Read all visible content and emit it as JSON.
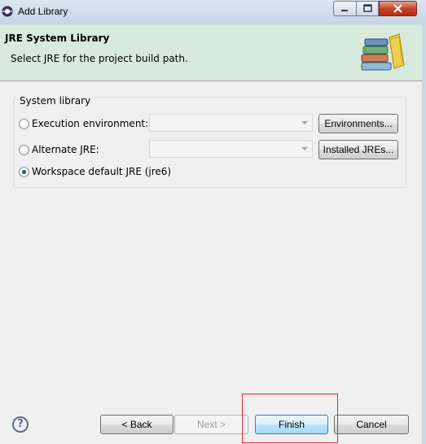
{
  "window": {
    "title": "Add Library",
    "controls": {
      "minimize": "minimize",
      "maximize": "maximize",
      "close": "close"
    }
  },
  "header": {
    "title": "JRE System Library",
    "description": "Select JRE for the project build path.",
    "icon": "library-books-icon"
  },
  "group": {
    "legend": "System library",
    "options": [
      {
        "label": "Execution environment:",
        "selected": false,
        "combo_value": "",
        "button": "Environments..."
      },
      {
        "label": "Alternate JRE:",
        "selected": false,
        "combo_value": "",
        "button": "Installed JREs..."
      },
      {
        "label": "Workspace default JRE (jre6)",
        "selected": true
      }
    ]
  },
  "footer": {
    "help": "?",
    "back": "< Back",
    "next": "Next >",
    "finish": "Finish",
    "cancel": "Cancel"
  },
  "colors": {
    "header_bg": "#d8eadb",
    "highlight": "#e0262b",
    "body_bg": "#f0f0f0"
  }
}
